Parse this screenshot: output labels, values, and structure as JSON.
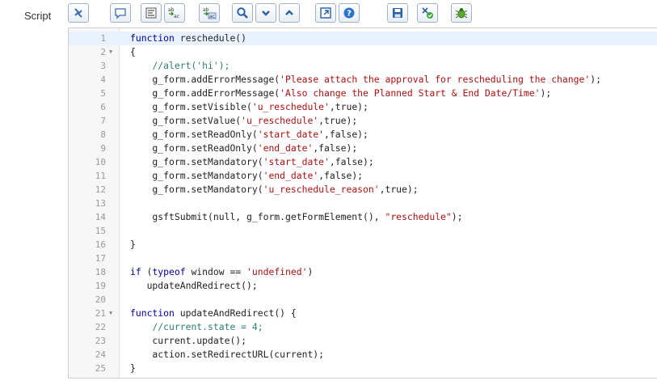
{
  "field": {
    "label": "Script"
  },
  "toolbar": {
    "buttons": [
      {
        "name": "toggle-syntax-button",
        "icon": "syntax-toggle-icon",
        "title": "Toggle syntax editor"
      },
      {
        "name": "toggle-comment-button",
        "icon": "comment-icon",
        "title": "Toggle comment"
      },
      {
        "name": "format-code-button",
        "icon": "format-icon",
        "title": "Format code"
      },
      {
        "name": "replace-button",
        "icon": "replace-icon",
        "title": "Replace"
      },
      {
        "name": "replace-all-button",
        "icon": "replace-all-icon",
        "title": "Replace all"
      },
      {
        "name": "search-button",
        "icon": "search-icon",
        "title": "Search"
      },
      {
        "name": "find-next-button",
        "icon": "chevron-down-icon",
        "title": "Find next"
      },
      {
        "name": "find-previous-button",
        "icon": "chevron-up-icon",
        "title": "Find previous"
      },
      {
        "name": "fullscreen-button",
        "icon": "expand-icon",
        "title": "Toggle full screen"
      },
      {
        "name": "help-button",
        "icon": "help-icon",
        "title": "Help"
      },
      {
        "name": "save-button",
        "icon": "save-icon",
        "title": "Save"
      },
      {
        "name": "script-check-button",
        "icon": "script-check-icon",
        "title": "Script check"
      },
      {
        "name": "debug-button",
        "icon": "bug-icon",
        "title": "Debug"
      }
    ]
  },
  "editor": {
    "active_line": 1,
    "lines": [
      {
        "n": "1",
        "fold": "",
        "tokens": [
          {
            "t": "kw",
            "v": "function"
          },
          {
            "t": "",
            "v": " reschedule()"
          }
        ]
      },
      {
        "n": "2",
        "fold": "▼",
        "tokens": [
          {
            "t": "",
            "v": "{"
          }
        ]
      },
      {
        "n": "3",
        "fold": "",
        "tokens": [
          {
            "t": "",
            "v": "    "
          },
          {
            "t": "cm",
            "v": "//alert('hi');"
          }
        ]
      },
      {
        "n": "4",
        "fold": "",
        "tokens": [
          {
            "t": "",
            "v": "    g_form.addErrorMessage("
          },
          {
            "t": "str",
            "v": "'Please attach the approval for rescheduling the change'"
          },
          {
            "t": "",
            "v": ");"
          }
        ]
      },
      {
        "n": "5",
        "fold": "",
        "tokens": [
          {
            "t": "",
            "v": "    g_form.addErrorMessage("
          },
          {
            "t": "str",
            "v": "'Also change the Planned Start & End Date/Time'"
          },
          {
            "t": "",
            "v": ");"
          }
        ]
      },
      {
        "n": "6",
        "fold": "",
        "tokens": [
          {
            "t": "",
            "v": "    g_form.setVisible("
          },
          {
            "t": "str",
            "v": "'u_reschedule'"
          },
          {
            "t": "",
            "v": ",true);"
          }
        ]
      },
      {
        "n": "7",
        "fold": "",
        "tokens": [
          {
            "t": "",
            "v": "    g_form.setValue("
          },
          {
            "t": "str",
            "v": "'u_reschedule'"
          },
          {
            "t": "",
            "v": ",true);"
          }
        ]
      },
      {
        "n": "8",
        "fold": "",
        "tokens": [
          {
            "t": "",
            "v": "    g_form.setReadOnly("
          },
          {
            "t": "str",
            "v": "'start_date'"
          },
          {
            "t": "",
            "v": ",false);"
          }
        ]
      },
      {
        "n": "9",
        "fold": "",
        "tokens": [
          {
            "t": "",
            "v": "    g_form.setReadOnly("
          },
          {
            "t": "str",
            "v": "'end_date'"
          },
          {
            "t": "",
            "v": ",false);"
          }
        ]
      },
      {
        "n": "10",
        "fold": "",
        "tokens": [
          {
            "t": "",
            "v": "    g_form.setMandatory("
          },
          {
            "t": "str",
            "v": "'start_date'"
          },
          {
            "t": "",
            "v": ",false);"
          }
        ]
      },
      {
        "n": "11",
        "fold": "",
        "tokens": [
          {
            "t": "",
            "v": "    g_form.setMandatory("
          },
          {
            "t": "str",
            "v": "'end_date'"
          },
          {
            "t": "",
            "v": ",false);"
          }
        ]
      },
      {
        "n": "12",
        "fold": "",
        "tokens": [
          {
            "t": "",
            "v": "    g_form.setMandatory("
          },
          {
            "t": "str",
            "v": "'u_reschedule_reason'"
          },
          {
            "t": "",
            "v": ",true);"
          }
        ]
      },
      {
        "n": "13",
        "fold": "",
        "tokens": [
          {
            "t": "",
            "v": ""
          }
        ]
      },
      {
        "n": "14",
        "fold": "",
        "tokens": [
          {
            "t": "",
            "v": "    gsftSubmit(null, g_form.getFormElement(), "
          },
          {
            "t": "str",
            "v": "\"reschedule\""
          },
          {
            "t": "",
            "v": ");"
          }
        ]
      },
      {
        "n": "15",
        "fold": "",
        "tokens": [
          {
            "t": "",
            "v": ""
          }
        ]
      },
      {
        "n": "16",
        "fold": "",
        "tokens": [
          {
            "t": "",
            "v": "}"
          }
        ]
      },
      {
        "n": "17",
        "fold": "",
        "tokens": [
          {
            "t": "",
            "v": ""
          }
        ]
      },
      {
        "n": "18",
        "fold": "",
        "tokens": [
          {
            "t": "kw",
            "v": "if"
          },
          {
            "t": "",
            "v": " ("
          },
          {
            "t": "kw",
            "v": "typeof"
          },
          {
            "t": "",
            "v": " window == "
          },
          {
            "t": "str",
            "v": "'undefined'"
          },
          {
            "t": "",
            "v": ")"
          }
        ]
      },
      {
        "n": "19",
        "fold": "",
        "tokens": [
          {
            "t": "",
            "v": "   updateAndRedirect();"
          }
        ]
      },
      {
        "n": "20",
        "fold": "",
        "tokens": [
          {
            "t": "",
            "v": ""
          }
        ]
      },
      {
        "n": "21",
        "fold": "▼",
        "tokens": [
          {
            "t": "kw",
            "v": "function"
          },
          {
            "t": "",
            "v": " updateAndRedirect() {"
          }
        ]
      },
      {
        "n": "22",
        "fold": "",
        "tokens": [
          {
            "t": "",
            "v": "    "
          },
          {
            "t": "cm",
            "v": "//current.state = 4;"
          }
        ]
      },
      {
        "n": "23",
        "fold": "",
        "tokens": [
          {
            "t": "",
            "v": "    current.update();"
          }
        ]
      },
      {
        "n": "24",
        "fold": "",
        "tokens": [
          {
            "t": "",
            "v": "    action.setRedirectURL(current);"
          }
        ]
      },
      {
        "n": "25",
        "fold": "",
        "tokens": [
          {
            "t": "",
            "v": "}"
          }
        ]
      }
    ]
  }
}
